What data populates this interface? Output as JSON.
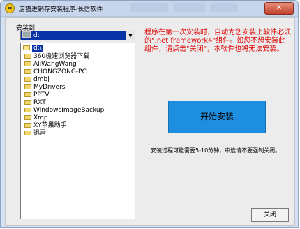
{
  "window": {
    "title": "店猫进销存安装程序-长信软件",
    "close_label": "✕"
  },
  "install_to": {
    "label": "安装到",
    "drive_selected": "d:",
    "tree_root": "d:\\",
    "folders": [
      "360极速浏览器下载",
      "AliWangWang",
      "CHONGZONG-PC",
      "dmbj",
      "MyDrivers",
      "PPTV",
      "RXT",
      "WindowsImageBackup",
      "Xmp",
      "XY苹果助手",
      "迅雷"
    ]
  },
  "note": "程序在第一次安装时，自动为您安装上软件必须的\".net framework4\"组件。如您不想安装此组件，请点击\"关闭\"，本软件也将无法安装。",
  "install_button": "开始安装",
  "info": "安装过程可能需要5-10分钟，中途请不要强制关闭。",
  "close_button": "关闭"
}
